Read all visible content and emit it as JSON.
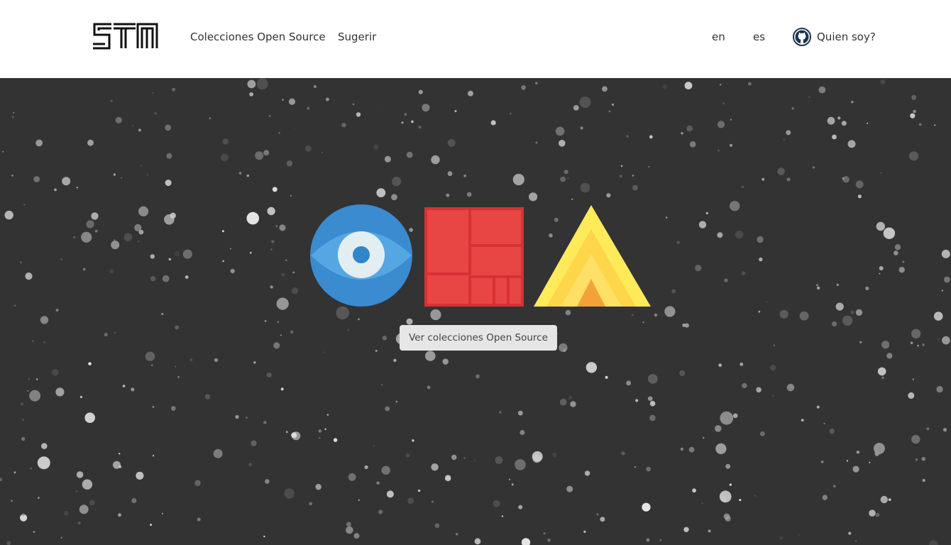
{
  "header": {
    "logo": "STM",
    "nav": {
      "collections": "Colecciones Open Source",
      "suggest": "Sugerir"
    },
    "languages": {
      "en": "en",
      "es": "es"
    },
    "github_icon": "github-icon",
    "about": "Quien soy?"
  },
  "hero": {
    "logos": [
      "eye-logo-icon",
      "grid-logo-icon",
      "triangle-logo-icon"
    ],
    "cta_label": "Ver colecciones Open Source"
  },
  "colors": {
    "background": "#333333",
    "eye_blue": "#3b8bd0",
    "grid_red": "#e84545",
    "triangle_yellow": "#ffd54a"
  }
}
